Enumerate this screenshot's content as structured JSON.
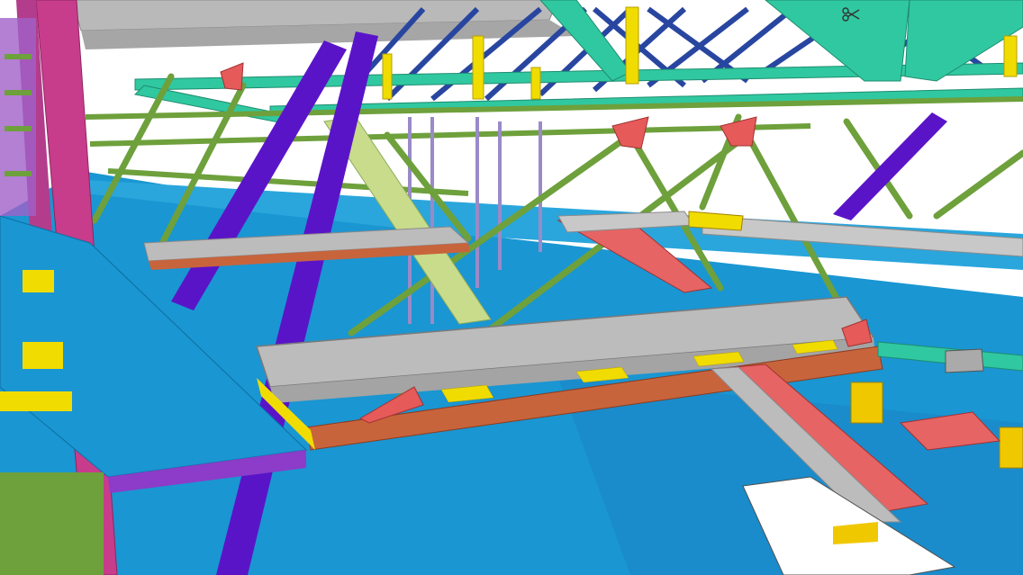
{
  "viewer": {
    "mode": "3d-model-view",
    "toolbar": {
      "cut_tool_icon": "scissors-icon"
    }
  },
  "palette": {
    "floor_slab": "#1a96d2",
    "steel_beam_grey": "#b4b4b4",
    "purple_column": "#5a14c8",
    "magenta_column": "#c83c8c",
    "green_tie_rod": "#6ea03c",
    "teal_truss": "#30c8a0",
    "navy_truss": "#2846a0",
    "yellow_member": "#f0dc00",
    "orange_girder": "#c8643c",
    "red_stair": "#e66464",
    "background": "#ffffff"
  }
}
